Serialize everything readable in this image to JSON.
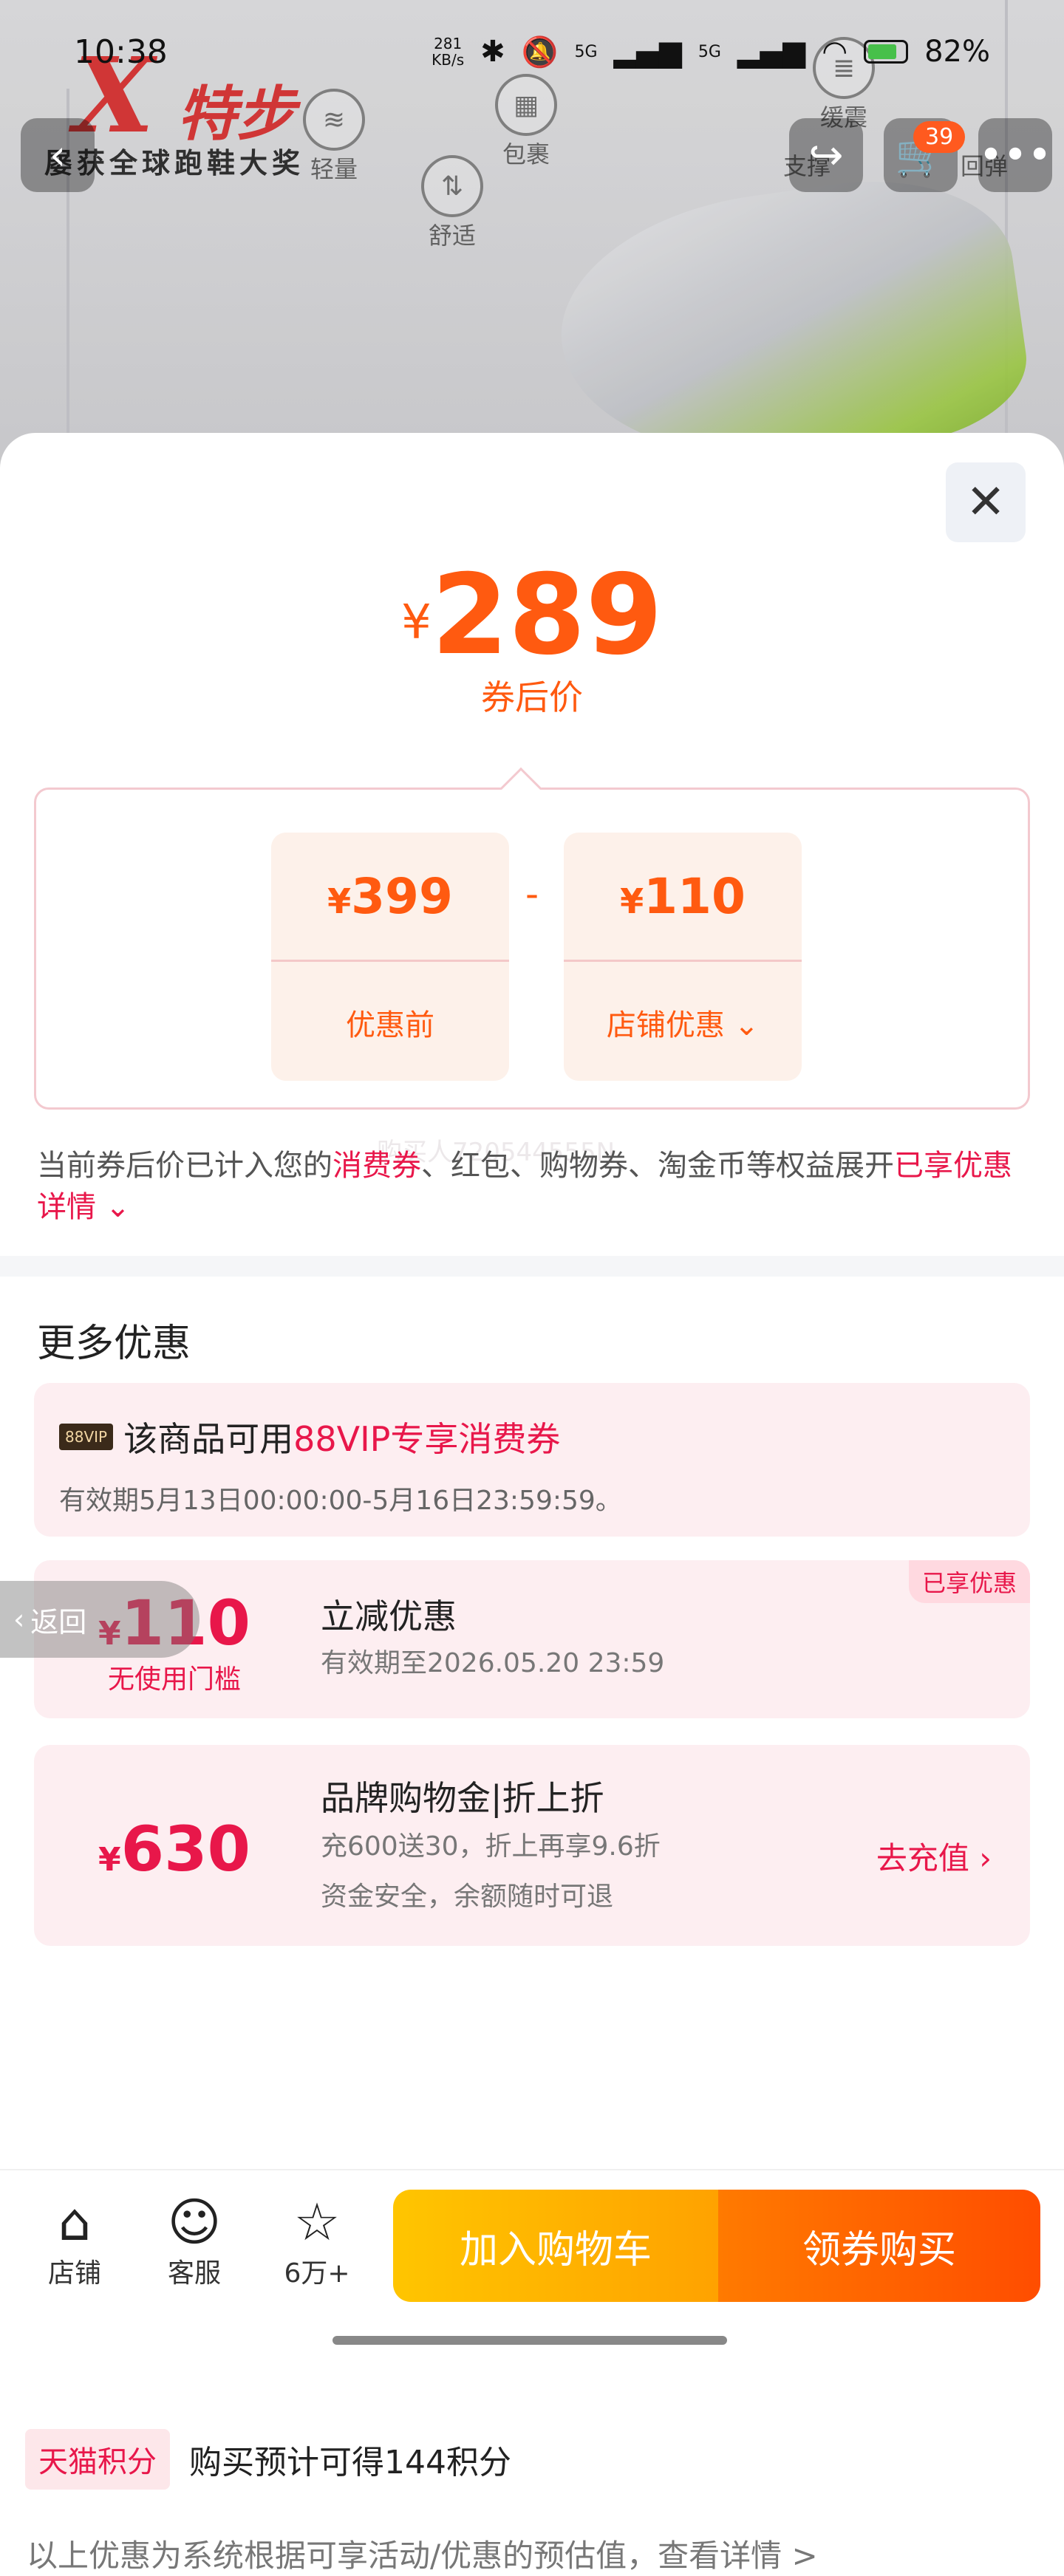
{
  "status_bar": {
    "time": "10:38",
    "speed_value": "281",
    "speed_unit": "KB/s",
    "signal_a": "5G",
    "signal_b": "5G",
    "battery": "82%"
  },
  "background": {
    "brand": "特步",
    "award": "屡获全球跑鞋大奖",
    "features": [
      "轻量",
      "包裹",
      "舒适",
      "缓震",
      "支撑",
      "回弹"
    ],
    "cart_count": "39"
  },
  "price": {
    "currency": "¥",
    "final": "289",
    "final_label": "券后价",
    "original": "399",
    "original_label": "优惠前",
    "discount": "110",
    "discount_label": "店铺优惠",
    "operator": "-"
  },
  "note": {
    "prefix": "当前券后价已计入您的",
    "highlight1": "消费券",
    "middle": "、红包、购物券、淘金币等权益展开",
    "highlight2": "已享优惠详情",
    "watermark": "购买人720544555N"
  },
  "more_offers": {
    "title": "更多优惠",
    "vip": {
      "tag": "88VIP",
      "prefix": "该商品可用",
      "highlight": "88VIP专享消费券",
      "validity": "有效期5月13日00:00:00-5月16日23:59:59。"
    },
    "instant": {
      "currency": "¥",
      "amount": "110",
      "sub": "无使用门槛",
      "title": "立减优惠",
      "validity": "有效期至2026.05.20 23:59",
      "badge": "已享优惠"
    },
    "brand_credit": {
      "currency": "¥",
      "amount": "630",
      "title": "品牌购物金|折上折",
      "line1": "充600送30，折上再享9.6折",
      "line2": "资金安全，余额随时可退",
      "action": "去充值 ›"
    },
    "points": {
      "tag": "天猫积分",
      "text": "购买预计可得144积分"
    },
    "disclaimer": "以上优惠为系统根据可享活动/优惠的预估值，查看详情 >"
  },
  "back_pill": "返回",
  "bottom_bar": {
    "store": "店铺",
    "service": "客服",
    "favorites": "6万+",
    "add_to_cart": "加入购物车",
    "buy": "领券购买"
  },
  "colors": {
    "accent": "#ff5a10",
    "highlight": "#e8174a",
    "cart_gradient_start": "#ffc500",
    "buy_gradient_end": "#ff4d00"
  }
}
